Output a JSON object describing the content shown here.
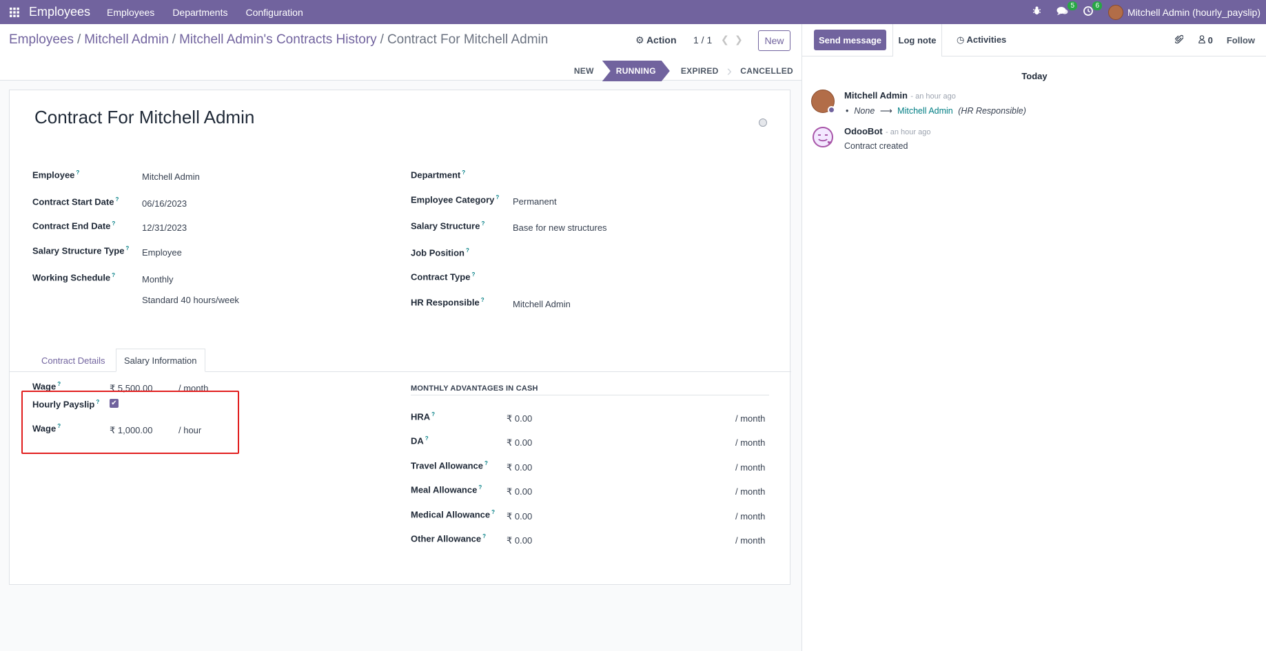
{
  "topbar": {
    "app_title": "Employees",
    "menu": [
      "Employees",
      "Departments",
      "Configuration"
    ],
    "messages_count": "5",
    "activities_count": "6",
    "user": "Mitchell Admin (hourly_payslip)"
  },
  "breadcrumb": {
    "items": [
      "Employees",
      "Mitchell Admin",
      "Mitchell Admin's Contracts History"
    ],
    "current": "Contract For Mitchell Admin"
  },
  "control": {
    "action_label": "Action",
    "pager": "1 / 1",
    "new_label": "New"
  },
  "statusbar": [
    "NEW",
    "RUNNING",
    "EXPIRED",
    "CANCELLED"
  ],
  "form": {
    "title": "Contract For Mitchell Admin",
    "left_fields": {
      "employee": {
        "label": "Employee",
        "value": "Mitchell Admin"
      },
      "start_date": {
        "label": "Contract Start Date",
        "value": "06/16/2023"
      },
      "end_date": {
        "label": "Contract End Date",
        "value": "12/31/2023"
      },
      "structure_type": {
        "label": "Salary Structure Type",
        "value": "Employee"
      },
      "schedule": {
        "label": "Working Schedule",
        "value": "Monthly",
        "value2": "Standard 40 hours/week"
      }
    },
    "right_fields": {
      "department": {
        "label": "Department",
        "value": ""
      },
      "category": {
        "label": "Employee Category",
        "value": "Permanent"
      },
      "structure": {
        "label": "Salary Structure",
        "value": "Base for new structures"
      },
      "job": {
        "label": "Job Position",
        "value": ""
      },
      "contract_type": {
        "label": "Contract Type",
        "value": ""
      },
      "hr_responsible": {
        "label": "HR Responsible",
        "value": "Mitchell Admin"
      }
    },
    "tabs": [
      "Contract Details",
      "Salary Information"
    ],
    "salary": {
      "wage": {
        "label": "Wage",
        "value": "₹ 5,500.00",
        "unit": "/ month"
      },
      "hourly": {
        "label": "Hourly Payslip",
        "checked": true
      },
      "hourly_wage": {
        "label": "Wage",
        "value": "₹ 1,000.00",
        "unit": "/ hour"
      }
    },
    "advantages": {
      "heading": "MONTHLY ADVANTAGES IN CASH",
      "rows": [
        {
          "label": "HRA",
          "value": "₹ 0.00",
          "unit": "/ month"
        },
        {
          "label": "DA",
          "value": "₹ 0.00",
          "unit": "/ month"
        },
        {
          "label": "Travel Allowance",
          "value": "₹ 0.00",
          "unit": "/ month"
        },
        {
          "label": "Meal Allowance",
          "value": "₹ 0.00",
          "unit": "/ month"
        },
        {
          "label": "Medical Allowance",
          "value": "₹ 0.00",
          "unit": "/ month"
        },
        {
          "label": "Other Allowance",
          "value": "₹ 0.00",
          "unit": "/ month"
        }
      ]
    }
  },
  "chatter": {
    "send_message": "Send message",
    "log_note": "Log note",
    "activities": "Activities",
    "followers_count": "0",
    "follow": "Follow",
    "day": "Today",
    "messages": [
      {
        "author": "Mitchell Admin",
        "time": "- an hour ago",
        "old": "None",
        "new": "Mitchell Admin",
        "field": "(HR Responsible)"
      },
      {
        "author": "OdooBot",
        "time": "- an hour ago",
        "text": "Contract created"
      }
    ]
  }
}
